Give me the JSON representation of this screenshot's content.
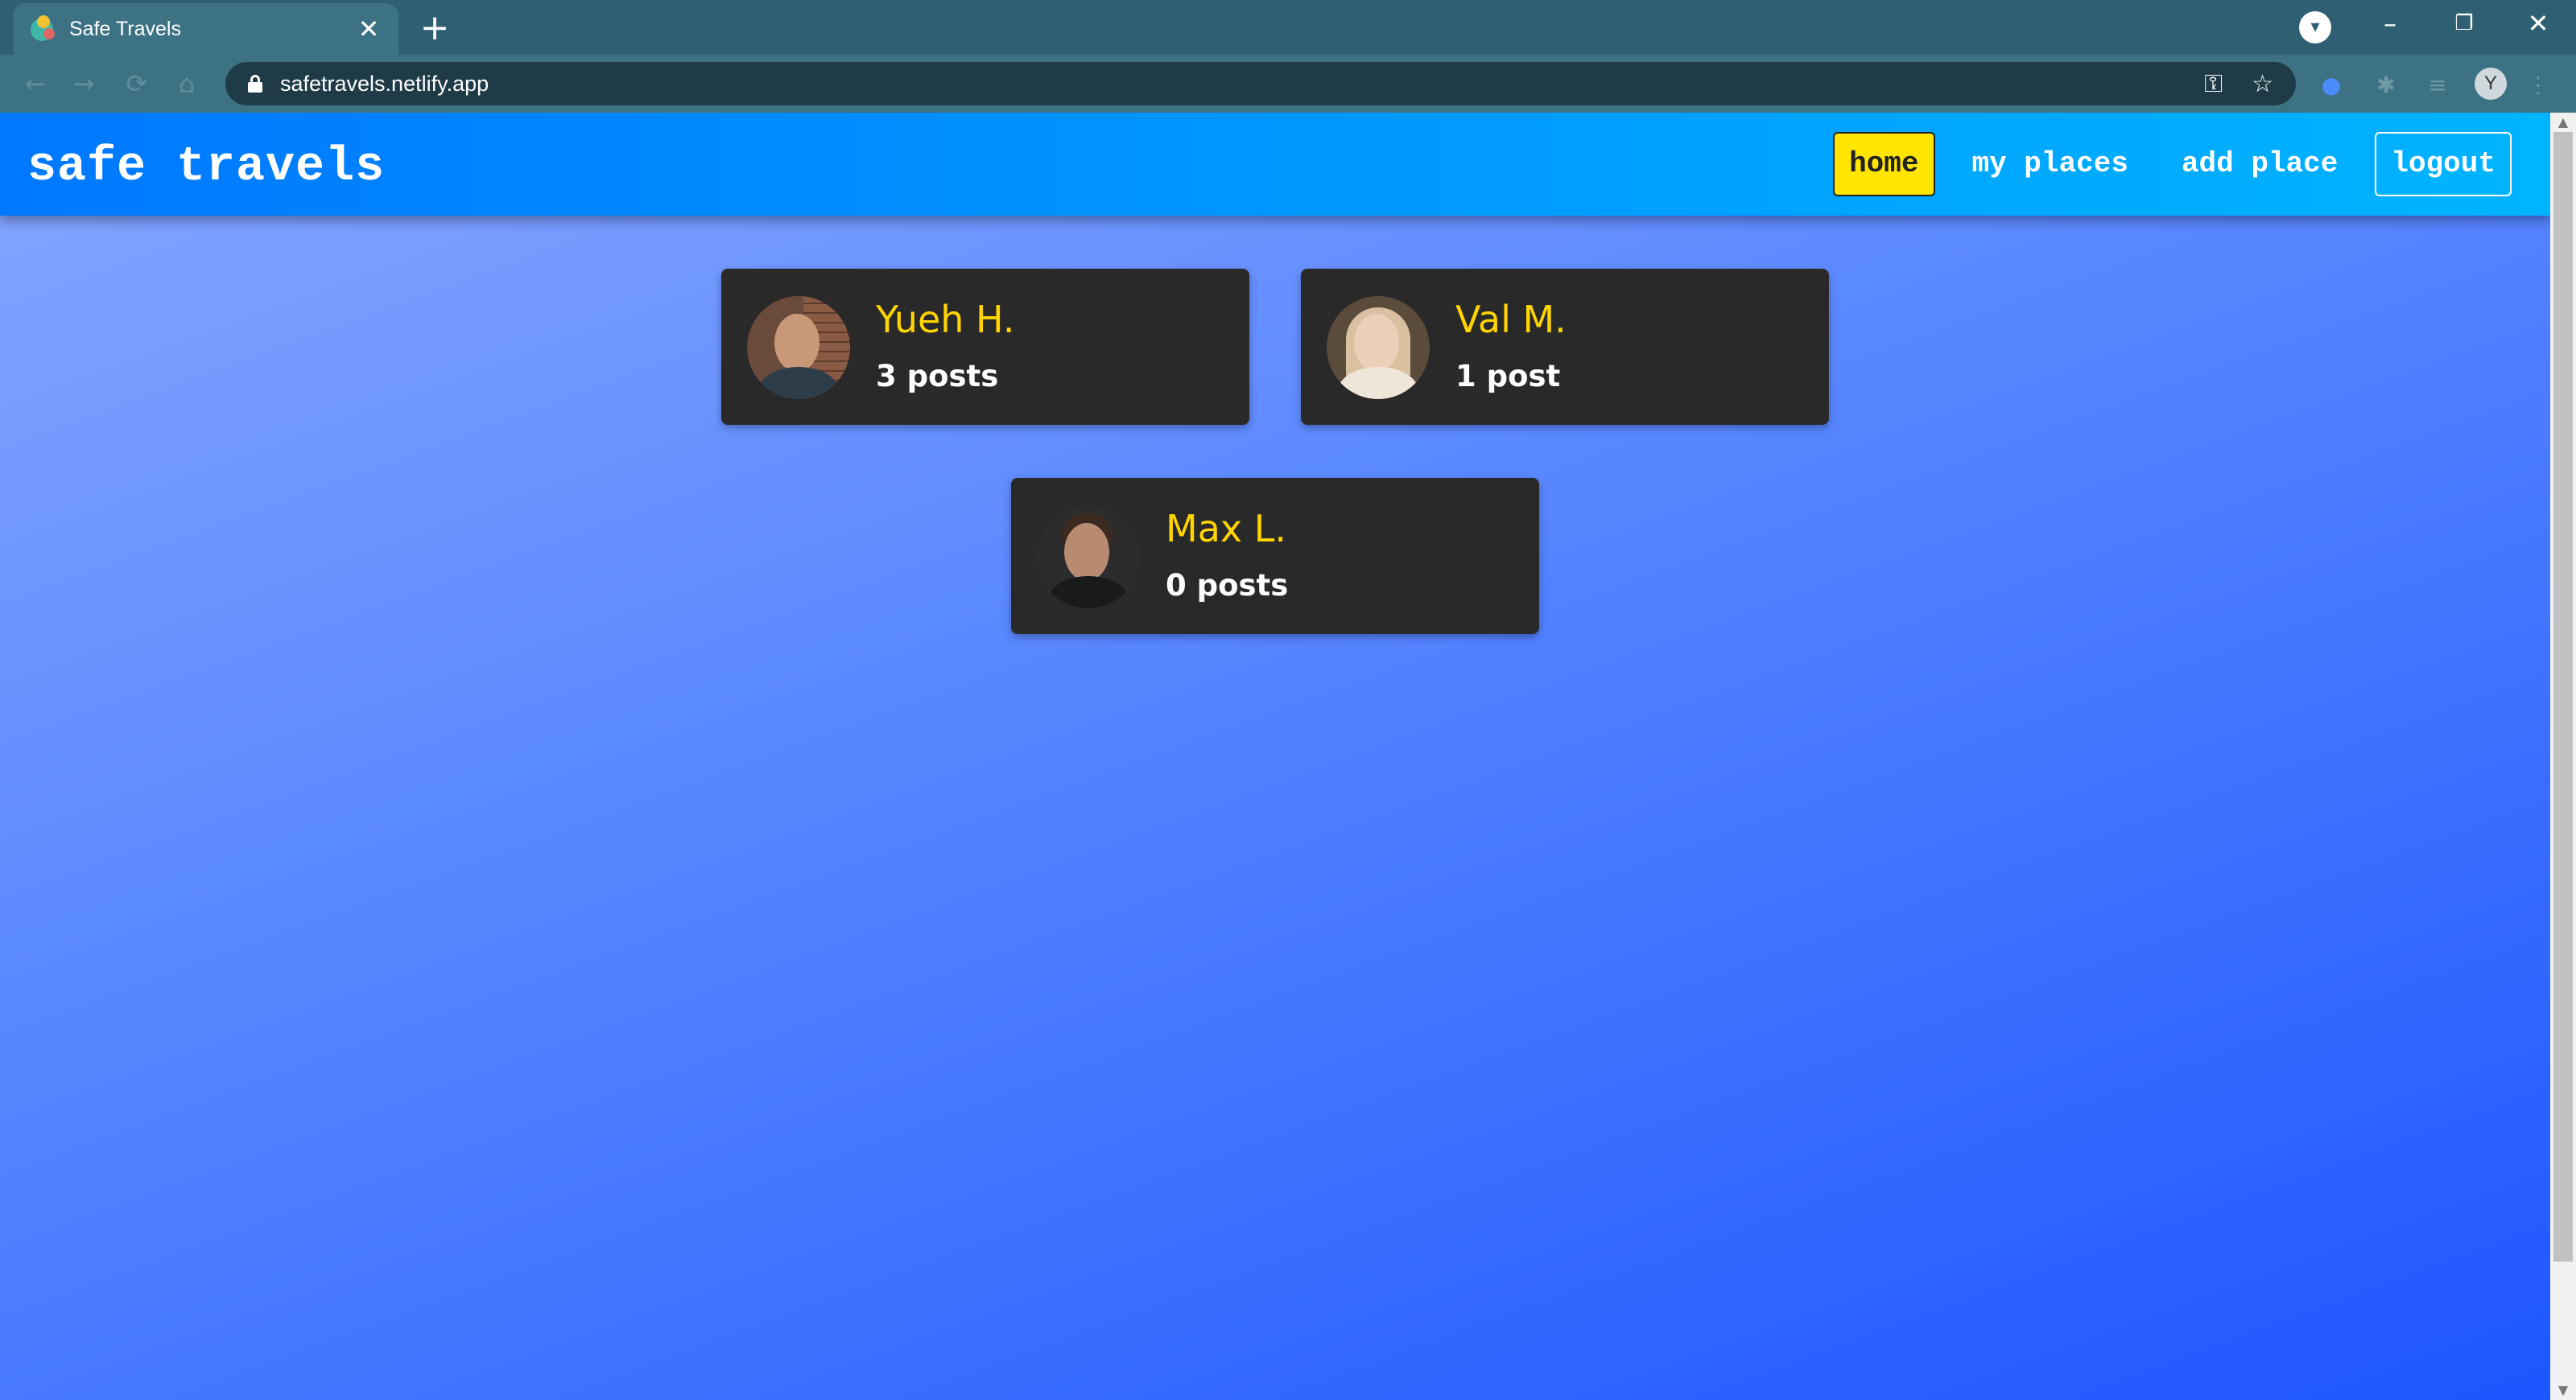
{
  "browser": {
    "tab_title": "Safe Travels",
    "url": "safetravels.netlify.app",
    "profile_initial": "Y"
  },
  "app": {
    "brand": "safe travels",
    "nav": {
      "home": "home",
      "my_places": "my places",
      "add_place": "add place",
      "logout": "logout"
    },
    "active_nav": "home",
    "colors": {
      "accent": "#ffe500",
      "name": "#ffd400",
      "card": "#292929"
    }
  },
  "users": [
    {
      "name": "Yueh H.",
      "posts": "3 posts"
    },
    {
      "name": "Val M.",
      "posts": "1 post"
    },
    {
      "name": "Max L.",
      "posts": "0 posts"
    }
  ]
}
